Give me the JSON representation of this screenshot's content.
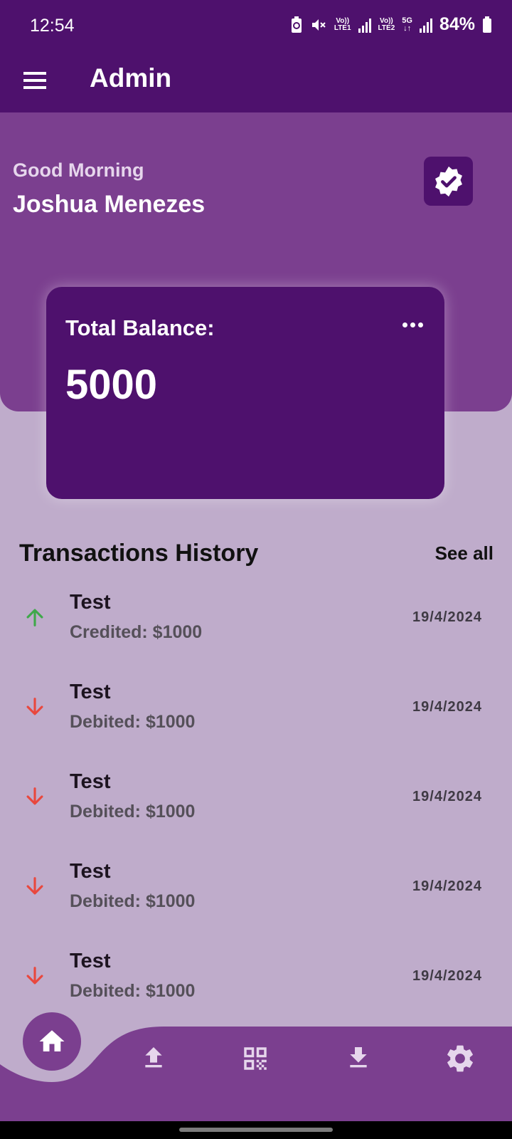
{
  "status_bar": {
    "time": "12:54",
    "battery": "84%",
    "icons": [
      "nfc-battery-icon",
      "mute-icon",
      "volte-lte1-icon",
      "signal-icon",
      "volte-lte2-icon",
      "5g-icon",
      "signal-icon",
      "battery-icon"
    ],
    "lte1": "LTE1",
    "lte2": "LTE2",
    "net": "5G"
  },
  "app_bar": {
    "title": "Admin",
    "menu_icon": "hamburger-icon"
  },
  "header": {
    "greeting": "Good Morning",
    "user_name": "Joshua Menezes",
    "badge_icon": "verified-badge-icon"
  },
  "balance_card": {
    "label": "Total Balance:",
    "value": "5000",
    "menu_icon": "more-horizontal-icon"
  },
  "transactions": {
    "title": "Transactions History",
    "see_all": "See all",
    "items": [
      {
        "name": "Test",
        "desc": "Credited: $1000",
        "date": "19/4/2024",
        "type": "credit"
      },
      {
        "name": "Test",
        "desc": "Debited: $1000",
        "date": "19/4/2024",
        "type": "debit"
      },
      {
        "name": "Test",
        "desc": "Debited: $1000",
        "date": "19/4/2024",
        "type": "debit"
      },
      {
        "name": "Test",
        "desc": "Debited: $1000",
        "date": "19/4/2024",
        "type": "debit"
      },
      {
        "name": "Test",
        "desc": "Debited: $1000",
        "date": "19/4/2024",
        "type": "debit"
      }
    ]
  },
  "bottom_nav": {
    "items": [
      "home-icon",
      "upload-icon",
      "qr-code-icon",
      "download-icon",
      "settings-icon"
    ],
    "active": "home-icon"
  },
  "colors": {
    "primary_dark": "#4e116d",
    "primary": "#7b3f8f",
    "background": "#bfaccb",
    "credit": "#3fa84a",
    "debit": "#e9473d"
  }
}
